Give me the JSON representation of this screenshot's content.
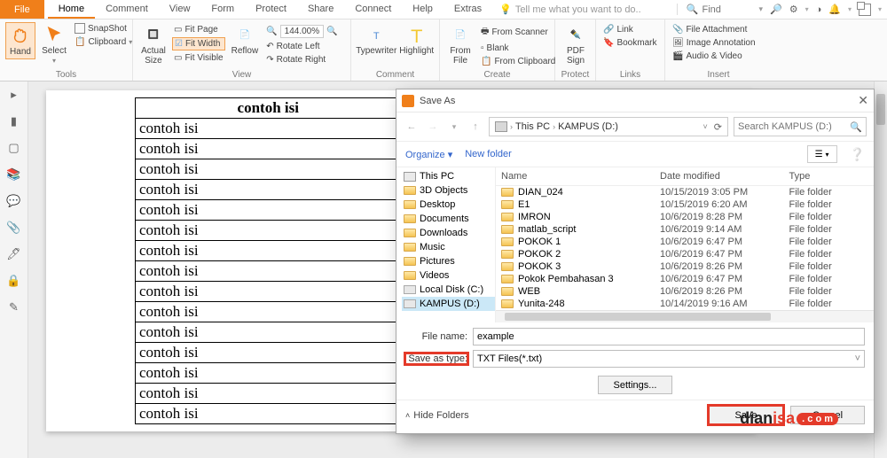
{
  "menu": {
    "file": "File",
    "tabs": [
      "Home",
      "Comment",
      "View",
      "Form",
      "Protect",
      "Share",
      "Connect",
      "Help",
      "Extras"
    ],
    "active": 0,
    "tell": "Tell me what you want to do..",
    "find": "Find"
  },
  "ribbon": {
    "tools": {
      "hand": "Hand",
      "select": "Select",
      "snapshot": "SnapShot",
      "clipboard": "Clipboard",
      "label": "Tools"
    },
    "view": {
      "actual": "Actual\nSize",
      "fit_page": "Fit Page",
      "fit_width": "Fit Width",
      "fit_visible": "Fit Visible",
      "reflow": "Reflow",
      "rotate_left": "Rotate Left",
      "rotate_right": "Rotate Right",
      "zoom": "144.00%",
      "label": "View"
    },
    "comment": {
      "typewriter": "Typewriter",
      "highlight": "Highlight",
      "label": "Comment"
    },
    "create": {
      "from_file": "From\nFile",
      "from_scanner": "From Scanner",
      "blank": "Blank",
      "from_clipboard": "From Clipboard",
      "label": "Create"
    },
    "protect": {
      "pdf_sign": "PDF\nSign",
      "label": "Protect"
    },
    "links": {
      "link": "Link",
      "bookmark": "Bookmark",
      "label": "Links"
    },
    "insert": {
      "file_attach": "File Attachment",
      "image_annot": "Image Annotation",
      "audio_video": "Audio & Video",
      "label": "Insert"
    }
  },
  "table": {
    "headers": [
      "contoh isi",
      "contoh isi"
    ],
    "rows": 15,
    "cell": "contoh isi"
  },
  "dialog": {
    "title": "Save As",
    "path": {
      "root": "This PC",
      "drive": "KAMPUS (D:)"
    },
    "search_placeholder": "Search KAMPUS (D:)",
    "organize": "Organize",
    "new_folder": "New folder",
    "tree": [
      {
        "name": "This PC",
        "icon": "pc"
      },
      {
        "name": "3D Objects",
        "icon": "folder"
      },
      {
        "name": "Desktop",
        "icon": "folder"
      },
      {
        "name": "Documents",
        "icon": "folder"
      },
      {
        "name": "Downloads",
        "icon": "folder"
      },
      {
        "name": "Music",
        "icon": "folder"
      },
      {
        "name": "Pictures",
        "icon": "folder"
      },
      {
        "name": "Videos",
        "icon": "folder"
      },
      {
        "name": "Local Disk (C:)",
        "icon": "drive"
      },
      {
        "name": "KAMPUS (D:)",
        "icon": "drive",
        "selected": true
      }
    ],
    "columns": {
      "name": "Name",
      "date": "Date modified",
      "type": "Type"
    },
    "items": [
      {
        "name": "DIAN_024",
        "date": "10/15/2019 3:05 PM",
        "type": "File folder"
      },
      {
        "name": "E1",
        "date": "10/15/2019 6:20 AM",
        "type": "File folder"
      },
      {
        "name": "IMRON",
        "date": "10/6/2019 8:28 PM",
        "type": "File folder"
      },
      {
        "name": "matlab_script",
        "date": "10/6/2019 9:14 AM",
        "type": "File folder"
      },
      {
        "name": "POKOK 1",
        "date": "10/6/2019 6:47 PM",
        "type": "File folder"
      },
      {
        "name": "POKOK 2",
        "date": "10/6/2019 6:47 PM",
        "type": "File folder"
      },
      {
        "name": "POKOK 3",
        "date": "10/6/2019 8:26 PM",
        "type": "File folder"
      },
      {
        "name": "Pokok Pembahasan 3",
        "date": "10/6/2019 6:47 PM",
        "type": "File folder"
      },
      {
        "name": "WEB",
        "date": "10/6/2019 8:26 PM",
        "type": "File folder"
      },
      {
        "name": "Yunita-248",
        "date": "10/14/2019 9:16 AM",
        "type": "File folder"
      }
    ],
    "file_name_label": "File name:",
    "file_name": "example",
    "save_type_label": "Save as type:",
    "save_type": "TXT Files(*.txt)",
    "settings": "Settings...",
    "hide_folders": "Hide Folders",
    "save": "Save",
    "cancel": "Cancel"
  },
  "watermark": {
    "a": "dian",
    "b": "isa",
    "dot": ". c o m"
  }
}
